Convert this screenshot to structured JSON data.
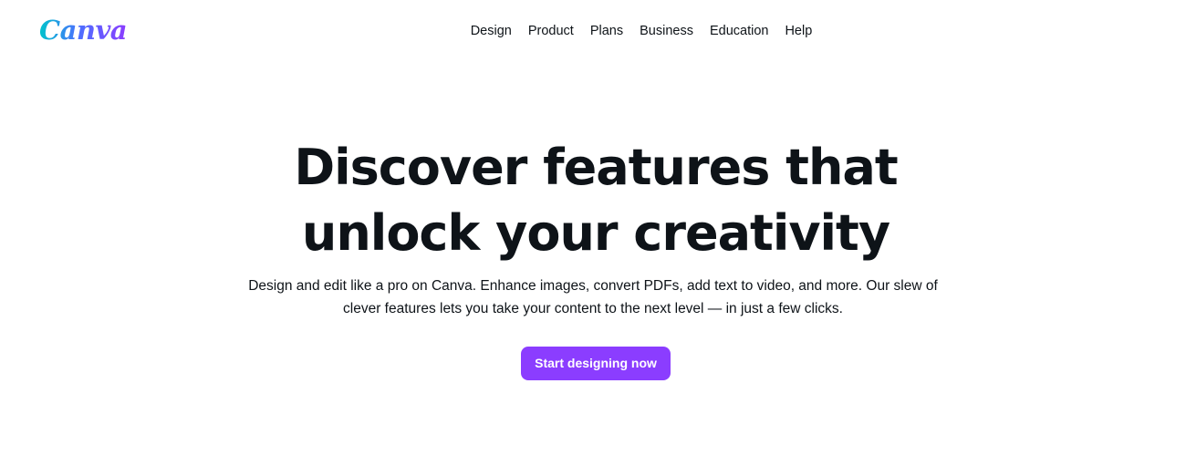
{
  "header": {
    "logo_text": "Canva",
    "nav": [
      {
        "label": "Design"
      },
      {
        "label": "Product"
      },
      {
        "label": "Plans"
      },
      {
        "label": "Business"
      },
      {
        "label": "Education"
      },
      {
        "label": "Help"
      }
    ]
  },
  "hero": {
    "headline_line1": "Discover features that",
    "headline_line2": "unlock your creativity",
    "subtext_line1": "Design and edit like a pro on Canva. Enhance images, convert PDFs, add text to video, and more. Our slew of",
    "subtext_line2": "clever features lets you take your content to the next level — in just a few clicks.",
    "cta_label": "Start designing now"
  },
  "colors": {
    "brand_purple": "#8b3dff",
    "logo_gradient_start": "#00c4cc",
    "logo_gradient_end": "#8b3dff",
    "text": "#0e1318",
    "background": "#ffffff"
  }
}
